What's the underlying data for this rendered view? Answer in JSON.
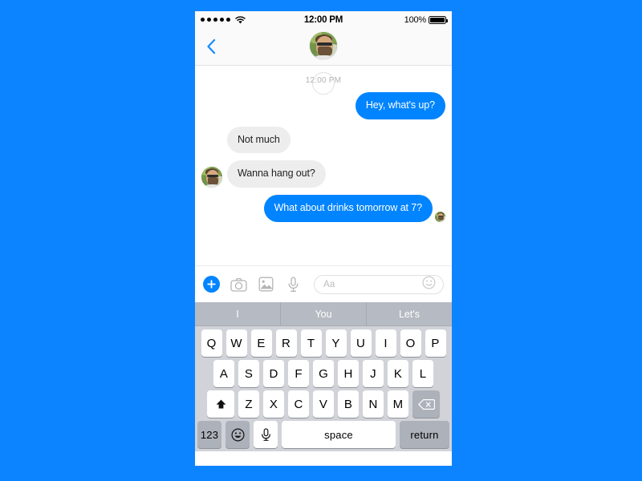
{
  "theme": {
    "page_background": "#0D84FF",
    "accent_blue": "#0084FF",
    "bubble_gray": "#EDEDED",
    "keyboard_background": "#D1D3D9",
    "predictive_background": "#B6BAC2"
  },
  "status_bar": {
    "signal_dots": 5,
    "wifi_icon": "wifi-icon",
    "time": "12:00 PM",
    "battery_percent": "100%",
    "battery_icon": "battery-full-icon"
  },
  "nav_bar": {
    "back_icon": "chevron-left-icon",
    "avatar_icon": "contact-avatar"
  },
  "thread": {
    "timestamp": "12:00 PM",
    "messages": [
      {
        "id": "m1",
        "side": "out",
        "text": "Hey, what's up?",
        "avatar": false,
        "receipt": false
      },
      {
        "id": "m2",
        "side": "in",
        "text": "Not much",
        "avatar": false,
        "receipt": false
      },
      {
        "id": "m3",
        "side": "in",
        "text": "Wanna hang out?",
        "avatar": true,
        "receipt": false
      },
      {
        "id": "m4",
        "side": "out",
        "text": "What about drinks tomorrow at 7?",
        "avatar": false,
        "receipt": true
      }
    ]
  },
  "composer": {
    "plus_icon": "plus-circle-icon",
    "camera_icon": "camera-icon",
    "photo_icon": "photo-library-icon",
    "mic_icon": "microphone-icon",
    "input_placeholder": "Aa",
    "input_value": "",
    "emoji_icon": "smiley-icon"
  },
  "keyboard": {
    "predictions": [
      "I",
      "You",
      "Let's"
    ],
    "row1": [
      "Q",
      "W",
      "E",
      "R",
      "T",
      "Y",
      "U",
      "I",
      "O",
      "P"
    ],
    "row2": [
      "A",
      "S",
      "D",
      "F",
      "G",
      "H",
      "J",
      "K",
      "L"
    ],
    "row3": [
      "Z",
      "X",
      "C",
      "V",
      "B",
      "N",
      "M"
    ],
    "shift_icon": "shift-up-icon",
    "backspace_icon": "backspace-delete-icon",
    "numeric_label": "123",
    "emoji_icon": "smiley-key-icon",
    "dictation_icon": "microphone-key-icon",
    "space_label": "space",
    "return_label": "return"
  }
}
